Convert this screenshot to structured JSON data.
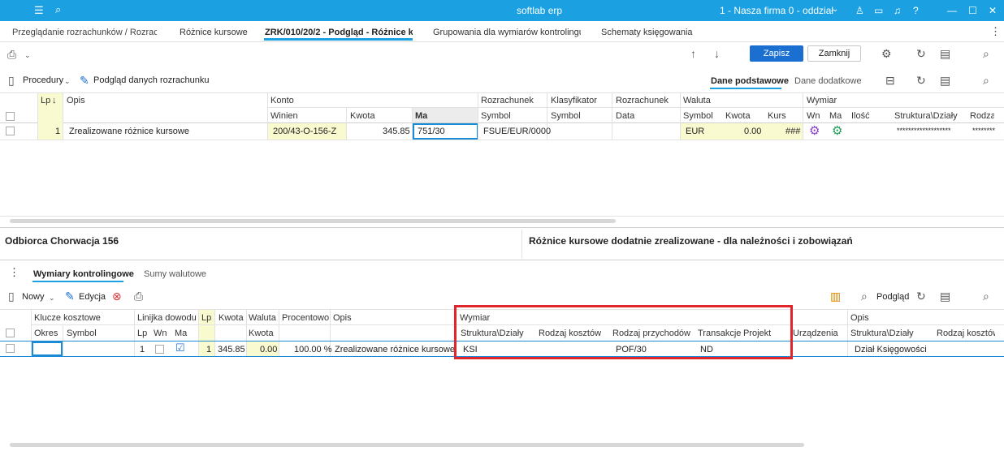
{
  "window": {
    "title": "softlab erp",
    "company": "1 - Nasza firma 0 - oddział"
  },
  "tabs": [
    "Przeglądanie rozrachunków / Rozrachu",
    "Różnice kursowe",
    "ZRK/010/20/2 - Podgląd - Różnice ku",
    "Grupowania dla wymiarów kontrolingu",
    "Schematy księgowania"
  ],
  "toolbar": {
    "save": "Zapisz",
    "close": "Zamknij"
  },
  "toolbar2": {
    "procedures": "Procedury",
    "preview": "Podgląd danych rozrachunku",
    "tab_basic": "Dane podstawowe",
    "tab_extra": "Dane dodatkowe"
  },
  "grid1": {
    "h_lp": "Lp",
    "h_opis": "Opis",
    "h_konto": "Konto",
    "h_rozrachunek": "Rozrachunek",
    "h_klasyfikator": "Klasyfikator",
    "h_rozrachunek2": "Rozrachunek",
    "h_waluta": "Waluta",
    "h_wymiar": "Wymiar",
    "h_winien": "Winien",
    "h_kwota": "Kwota",
    "h_ma": "Ma",
    "h_symbol": "Symbol",
    "h_symbol2": "Symbol",
    "h_data": "Data",
    "h_symbol3": "Symbol",
    "h_kwota2": "Kwota",
    "h_kurs": "Kurs",
    "h_wn": "Wn",
    "h_ma2": "Ma",
    "h_ilosc": "Ilość",
    "h_struktura": "Struktura\\Działy",
    "h_rodzaj": "Rodza",
    "row": {
      "lp": "1",
      "opis": "Zrealizowane różnice kursowe",
      "winien": "200/43-O-156-Z",
      "kwota": "345.85",
      "ma": "751/30",
      "rozrachunek": "FSUE/EUR/0000",
      "waluta": "EUR",
      "kwota_w": "0.00",
      "kurs": "###",
      "struktura": "*******************",
      "rodzaj": "********"
    }
  },
  "info": {
    "left": "Odbiorca Chorwacja 156",
    "right": "Różnice kursowe dodatnie zrealizowane -  dla należności i zobowiązań"
  },
  "lower_tabs": {
    "wymiary": "Wymiary kontrolingowe",
    "sumy": "Sumy walutowe"
  },
  "lower_toolbar": {
    "new": "Nowy",
    "edit": "Edycja",
    "preview": "Podgląd"
  },
  "grid2": {
    "h_klucze": "Klucze kosztowe",
    "h_linijka": "Linijka dowodu",
    "h_lp": "Lp",
    "h_kwota": "Kwota",
    "h_waluta": "Waluta",
    "h_procentowo": "Procentowo",
    "h_opis": "Opis",
    "h_wymiar": "Wymiar",
    "h_opis2": "Opis",
    "h_okres": "Okres",
    "h_symbol": "Symbol",
    "h_lp2": "Lp",
    "h_wn": "Wn",
    "h_ma": "Ma",
    "h_kwota2": "Kwota",
    "h_struktura": "Struktura\\Działy",
    "h_rodzaj_k": "Rodzaj kosztów",
    "h_rodzaj_p": "Rodzaj przychodów",
    "h_transakcje": "Transakcje",
    "h_projekt": "Projekt",
    "h_urzadzenia": "Urządzenia",
    "h_struktura2": "Struktura\\Działy",
    "h_rodzaj_k2": "Rodzaj kosztów",
    "row": {
      "lp_line": "1",
      "lp": "1",
      "kwota": "345.85",
      "kwota_w": "0.00",
      "procent": "100.00 %",
      "opis": "Zrealizowane różnice kursowe",
      "struktura": "KSI",
      "rodzaj_p": "POF/30",
      "transakcje": "ND",
      "struktura2": "Dział Księgowości"
    }
  }
}
